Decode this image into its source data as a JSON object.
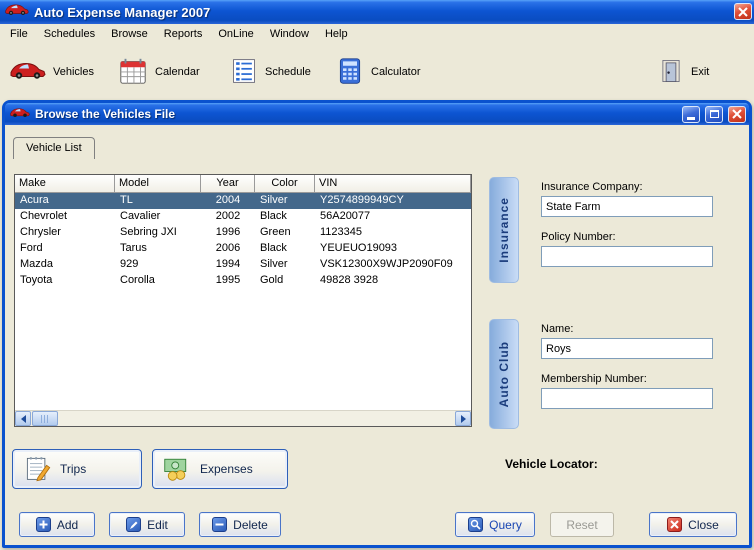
{
  "colors": {
    "window_border_blue": "#0A52CE",
    "titlebar_blue": "#0D55D2",
    "selection_blue": "#44688B",
    "close_red": "#CC2B1B",
    "desktop_gray": "#ECE9D8"
  },
  "app": {
    "title": "Auto Expense Manager 2007",
    "menu": [
      "File",
      "Schedules",
      "Browse",
      "Reports",
      "OnLine",
      "Window",
      "Help"
    ],
    "toolbar": {
      "vehicles": "Vehicles",
      "calendar": "Calendar",
      "schedule": "Schedule",
      "calculator": "Calculator",
      "exit": "Exit"
    }
  },
  "browse_window": {
    "title": "Browse the Vehicles File",
    "tab": "Vehicle List",
    "table": {
      "columns": [
        "Make",
        "Model",
        "Year",
        "Color",
        "VIN"
      ],
      "rows": [
        [
          "Acura",
          "TL",
          "2004",
          "Silver",
          "Y2574899949CY"
        ],
        [
          "Chevrolet",
          "Cavalier",
          "2002",
          "Black",
          "56A20077"
        ],
        [
          "Chrysler",
          "Sebring JXI",
          "1996",
          "Green",
          "1123345"
        ],
        [
          "Ford",
          "Tarus",
          "2006",
          "Black",
          "YEUEUO19093"
        ],
        [
          "Mazda",
          "929",
          "1994",
          "Silver",
          "VSK12300X9WJP2090F09"
        ],
        [
          "Toyota",
          "Corolla",
          "1995",
          "Gold",
          "49828 3928"
        ]
      ],
      "selected_row_index": 0
    },
    "insurance": {
      "panel_label": "Insurance",
      "company_label": "Insurance Company:",
      "company_value": "State Farm",
      "policy_label": "Policy Number:",
      "policy_value": ""
    },
    "auto_club": {
      "panel_label": "Auto Club",
      "name_label": "Name:",
      "name_value": "Roys",
      "membership_label": "Membership Number:",
      "membership_value": ""
    },
    "trips_button": "Trips",
    "expenses_button": "Expenses",
    "vehicle_locator_label": "Vehicle Locator:",
    "actions": {
      "add": "Add",
      "edit": "Edit",
      "delete": "Delete",
      "query": "Query",
      "reset": "Reset",
      "close": "Close"
    }
  }
}
